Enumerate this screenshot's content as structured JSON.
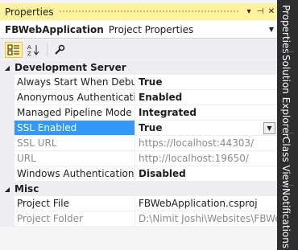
{
  "titlebar": {
    "title": "Properties",
    "pin_glyph": "⊣",
    "dropdown_glyph": "▾",
    "close_glyph": "✕"
  },
  "object_selector": {
    "name": "FBWebApplication",
    "type": "Project Properties"
  },
  "toolbar": {
    "categorized": "categorized-view",
    "alphabetical": "alphabetical-view",
    "property_pages": "property-pages"
  },
  "categories": [
    {
      "name": "Development Server",
      "rows": [
        {
          "name": "Always Start When Debugg",
          "value": "True",
          "bold": true
        },
        {
          "name": "Anonymous Authentication",
          "value": "Enabled",
          "bold": true
        },
        {
          "name": "Managed Pipeline Mode",
          "value": "Integrated",
          "bold": true
        },
        {
          "name": "SSL Enabled",
          "value": "True",
          "bold": true,
          "selected": true
        },
        {
          "name": "SSL URL",
          "value": "https://localhost:44303/",
          "disabled": true
        },
        {
          "name": "URL",
          "value": "http://localhost:19650/",
          "disabled": true
        },
        {
          "name": "Windows Authentication",
          "value": "Disabled",
          "bold": true
        }
      ]
    },
    {
      "name": "Misc",
      "rows": [
        {
          "name": "Project File",
          "value": "FBWebApplication.csproj"
        },
        {
          "name": "Project Folder",
          "value": "D:\\Nimit Joshi\\Websites\\FBWeb",
          "disabled": true
        }
      ]
    }
  ],
  "side_tabs": [
    "Properties",
    "Solution Explorer",
    "Class View",
    "Notifications"
  ]
}
